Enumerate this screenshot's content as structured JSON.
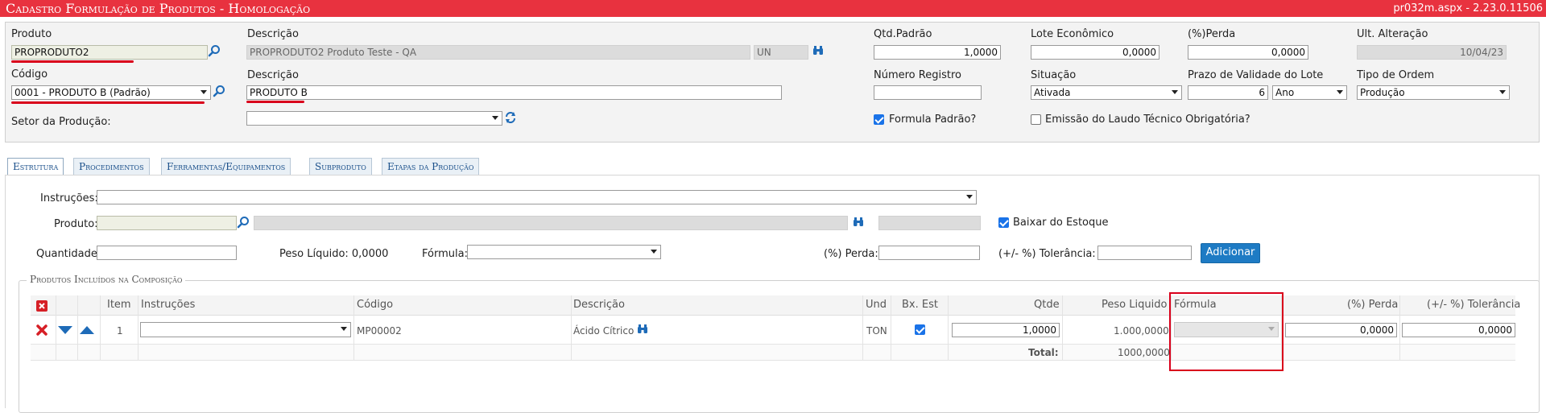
{
  "titlebar": {
    "title": "Cadastro Formulação de Produtos  - Homologação",
    "version": "pr032m.aspx - 2.23.0.11506"
  },
  "header": {
    "produto_label": "Produto",
    "produto_value": "PROPRODUTO2",
    "descricao_label": "Descrição",
    "descricao_value": "PROPRODUTO2 Produto Teste - QA",
    "unidade": "UN",
    "codigo_label": "Código",
    "codigo_value": "0001 - PRODUTO B (Padrão)",
    "descricao2_label": "Descrição",
    "descricao2_value": "PRODUTO B",
    "setor_label": "Setor da Produção:",
    "setor_value": "",
    "qtd_label": "Qtd.Padrão",
    "qtd_value": "1,0000",
    "lote_label": "Lote Econômico",
    "lote_value": "0,0000",
    "perda_label": "(%)Perda",
    "perda_value": "0,0000",
    "alteracao_label": "Ult. Alteração",
    "alteracao_value": "10/04/23",
    "registro_label": "Número Registro",
    "registro_value": "",
    "situacao_label": "Situação",
    "situacao_value": "Ativada",
    "prazo_label": "Prazo de Validade do Lote",
    "prazo_value": "6",
    "prazo_unit": "Ano",
    "tipo_label": "Tipo de Ordem",
    "tipo_value": "Produção",
    "formula_padrao_label": "Formula Padrão?",
    "formula_padrao_checked": true,
    "laudo_label": "Emissão do Laudo Técnico Obrigatória?",
    "laudo_checked": false
  },
  "tabs": [
    {
      "label": "Estrutura",
      "active": true
    },
    {
      "label": "Procedimentos",
      "active": false
    },
    {
      "label": "Ferramentas/Equipamentos",
      "active": false
    },
    {
      "label": "Subproduto",
      "active": false
    },
    {
      "label": "Etapas da Produção",
      "active": false
    }
  ],
  "form": {
    "instrucoes_label": "Instruções:",
    "instrucoes_value": "",
    "produto_label": "Produto:",
    "produto_value": "",
    "baixar_label": "Baixar do Estoque",
    "baixar_checked": true,
    "quantidade_label": "Quantidade:",
    "quantidade_value": "",
    "peso_liquido_text": "Peso Líquido: 0,0000",
    "formula_label": "Fórmula:",
    "formula_value": "",
    "perda_label": "(%) Perda:",
    "perda_value": "",
    "tolerancia_label": "(+/- %) Tolerância:",
    "tolerancia_value": "",
    "adicionar_label": "Adicionar"
  },
  "grid": {
    "legend": "Produtos Incluídos na Composição",
    "headers": {
      "item": "Item",
      "instrucoes": "Instruções",
      "codigo": "Código",
      "descricao": "Descrição",
      "und": "Und",
      "bx_est": "Bx. Est",
      "qtde": "Qtde",
      "peso": "Peso Liquido",
      "formula": "Fórmula",
      "perda": "(%) Perda",
      "tolerancia": "(+/- %) Tolerância"
    },
    "rows": [
      {
        "item": "1",
        "instrucoes": "",
        "codigo": "MP00002",
        "descricao": "Ácido Cítrico",
        "und": "TON",
        "bx_est": true,
        "qtde": "1,0000",
        "peso": "1.000,0000",
        "formula": "",
        "perda": "0,0000",
        "tolerancia": "0,0000"
      }
    ],
    "total_label": "Total:",
    "total_value": "1000,0000"
  },
  "colors": {
    "titlebar": "#e8323f",
    "annotation": "#d9001b",
    "primary_button": "#1e7bc4"
  }
}
